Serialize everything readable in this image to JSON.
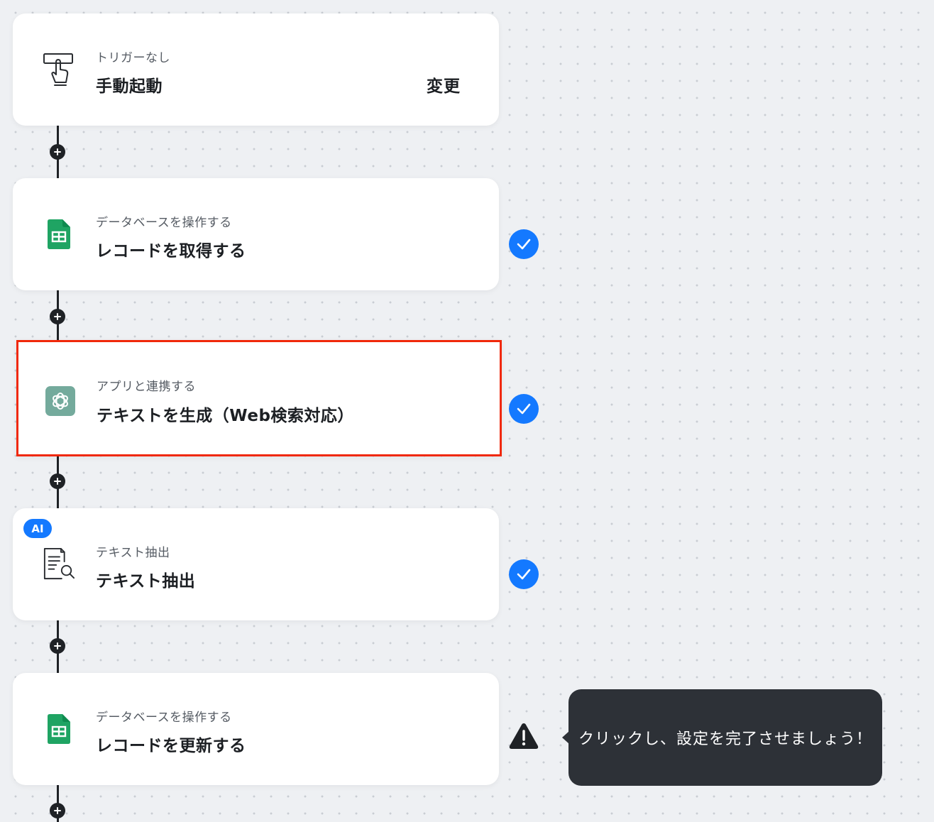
{
  "flow": {
    "steps": [
      {
        "sub": "トリガーなし",
        "main": "手動起動",
        "action": "変更",
        "icon": "hand-pointer-icon"
      },
      {
        "sub": "データベースを操作する",
        "main": "レコードを取得する",
        "icon": "google-sheets-icon",
        "status": "complete"
      },
      {
        "sub": "アプリと連携する",
        "main": "テキストを生成（Web検索対応）",
        "icon": "chatgpt-icon",
        "status": "complete",
        "highlighted": true
      },
      {
        "sub": "テキスト抽出",
        "main": "テキスト抽出",
        "icon": "document-search-icon",
        "badge": "AI",
        "status": "complete"
      },
      {
        "sub": "データベースを操作する",
        "main": "レコードを更新する",
        "icon": "google-sheets-icon",
        "status": "warning"
      }
    ]
  },
  "tooltip": {
    "text": "クリックし、設定を完了させましょう！"
  },
  "colors": {
    "accent": "#1479ff",
    "highlight": "#f0280a",
    "sheets": "#1fa463",
    "chatgpt": "#74aa9c",
    "tooltip": "#2d3137"
  }
}
